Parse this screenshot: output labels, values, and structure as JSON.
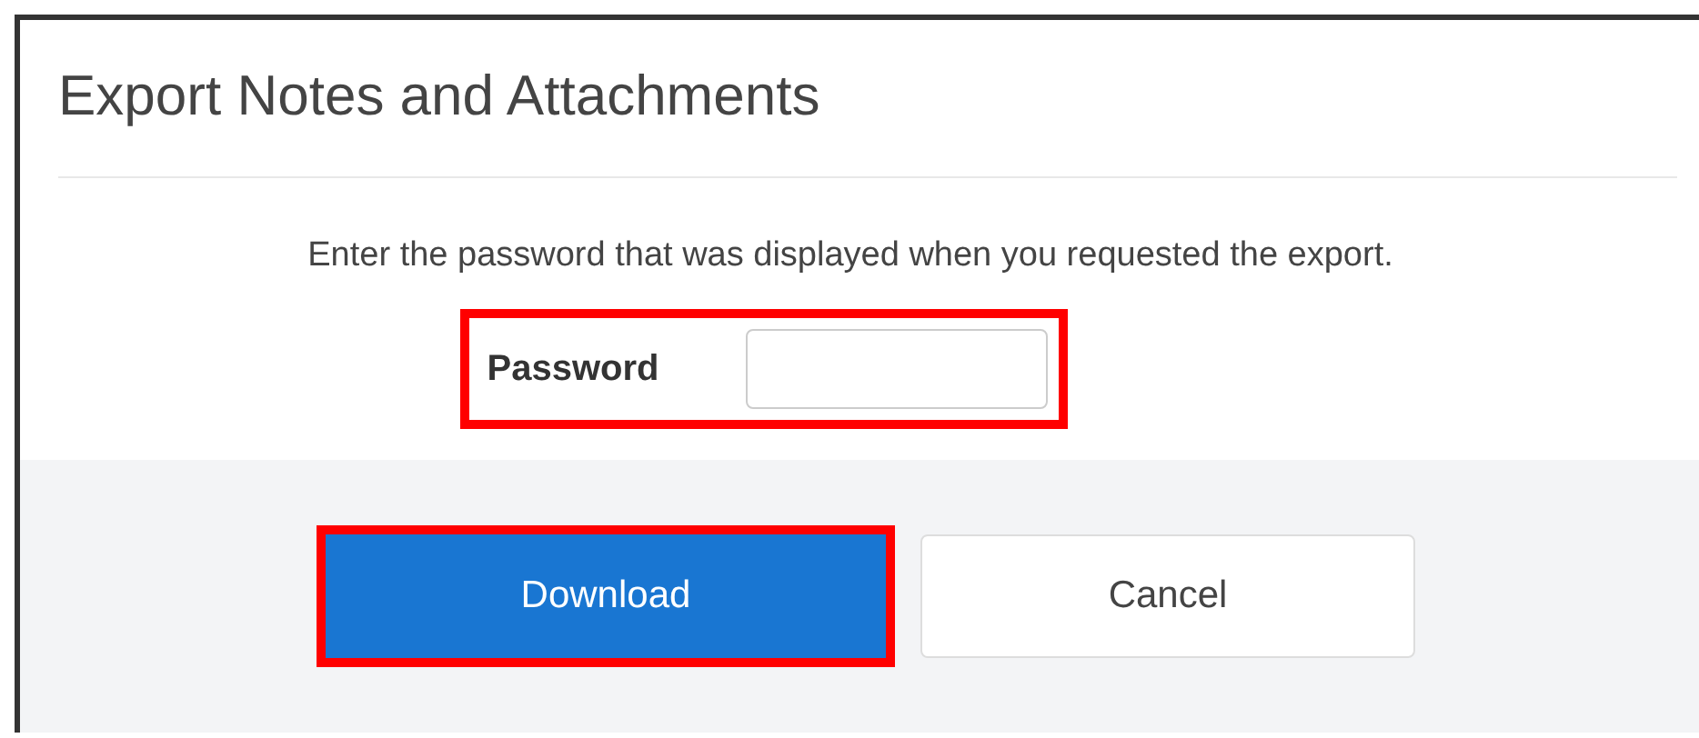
{
  "dialog": {
    "title": "Export Notes and Attachments",
    "instruction": "Enter the password that was displayed when you requested the export.",
    "password_field": {
      "label": "Password",
      "highlighted": true
    },
    "buttons": [
      {
        "label": "Download",
        "kind": "primary",
        "highlighted": true
      },
      {
        "label": "Cancel",
        "kind": "secondary",
        "highlighted": false
      }
    ]
  }
}
